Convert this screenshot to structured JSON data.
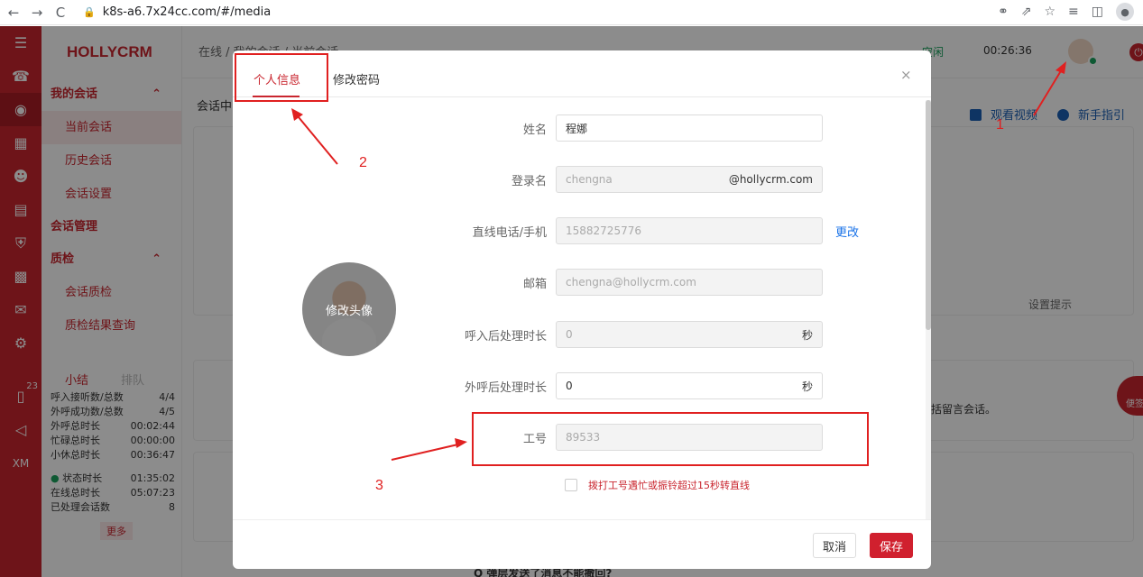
{
  "browser": {
    "url": "k8s-a6.7x24cc.com/#/media",
    "back": "←",
    "forward": "→",
    "reload": "C"
  },
  "app": {
    "brand": "HOLLYCRM",
    "breadcrumb": "在线 / 我的会话 / 当前会话",
    "status_idle": "空闲",
    "timer": "00:26:36",
    "content_label": "会话中",
    "help": {
      "video": "观看视频",
      "guide": "新手指引"
    },
    "card_caption": "设置提示",
    "side_text": "括留言会话。",
    "bottom_question": "Q 弹层发送了消息不能撤回?",
    "float_badge": "便签",
    "badge_count": "23",
    "rail_bottom": "XM"
  },
  "sidebar": {
    "group_my_sessions": "我的会话",
    "items_my": [
      "当前会话",
      "历史会话",
      "会话设置"
    ],
    "group_session_mgmt": "会话管理",
    "group_qc": "质检",
    "items_qc": [
      "会话质检",
      "质检结果查询"
    ],
    "stats_tabs": {
      "summary": "小结",
      "queue": "排队"
    },
    "stats": [
      {
        "label": "呼入接听数/总数",
        "value": "4/4"
      },
      {
        "label": "外呼成功数/总数",
        "value": "4/5"
      },
      {
        "label": "外呼总时长",
        "value": "00:02:44"
      },
      {
        "label": "忙碌总时长",
        "value": "00:00:00"
      },
      {
        "label": "小休总时长",
        "value": "00:36:47"
      },
      {
        "label": "状态时长",
        "value": "01:35:02"
      },
      {
        "label": "在线总时长",
        "value": "05:07:23"
      },
      {
        "label": "已处理会话数",
        "value": "8"
      }
    ],
    "more": "更多"
  },
  "modal": {
    "tab_profile": "个人信息",
    "tab_password": "修改密码",
    "close": "×",
    "avatar_label": "修改头像",
    "fields": {
      "name": {
        "label": "姓名",
        "value": "程娜"
      },
      "login": {
        "label": "登录名",
        "value": "chengna",
        "suffix": "@hollycrm.com"
      },
      "phone": {
        "label": "直线电话/手机",
        "value": "15882725776",
        "action": "更改"
      },
      "email": {
        "label": "邮箱",
        "value": "chengna@hollycrm.com"
      },
      "inbound_wrap": {
        "label": "呼入后处理时长",
        "value": "0",
        "unit": "秒"
      },
      "outbound_wrap": {
        "label": "外呼后处理时长",
        "value": "0",
        "unit": "秒"
      },
      "employee_id": {
        "label": "工号",
        "value": "89533"
      }
    },
    "checkbox_label": "拨打工号遇忙或振铃超过15秒转直线",
    "cancel": "取消",
    "save": "保存"
  },
  "annotations": [
    "1",
    "2",
    "3"
  ],
  "colors": {
    "brand_red": "#c9262f",
    "save_red": "#d0202e",
    "annotation": "#e02020",
    "idle_green": "#1aa35d",
    "link_blue": "#1a73e8"
  }
}
